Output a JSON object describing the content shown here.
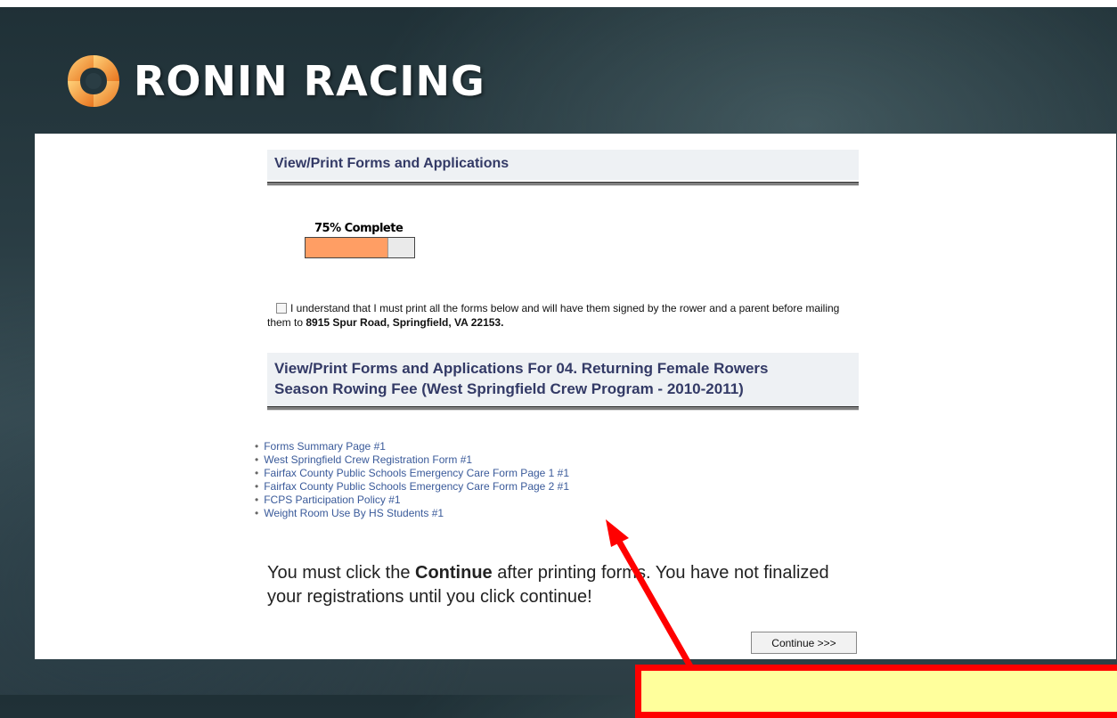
{
  "brand": {
    "name": "RONIN RACING"
  },
  "header1": {
    "title": "View/Print Forms and Applications"
  },
  "progress": {
    "label": "75% Complete",
    "percent": 75
  },
  "agreement": {
    "text": "I understand that I must print all the forms below and will have them signed by the rower and a parent before mailing them to ",
    "address": "8915 Spur Road, Springfield, VA 22153."
  },
  "header2": {
    "line1": "View/Print Forms and Applications For 04. Returning Female Rowers",
    "line2": "Season Rowing Fee (West Springfield Crew Program - 2010-2011)"
  },
  "forms": [
    "Forms Summary Page #1",
    "West Springfield Crew Registration Form #1",
    "Fairfax County Public Schools Emergency Care Form Page 1 #1",
    "Fairfax County Public Schools Emergency Care Form Page 2 #1",
    "FCPS Participation Policy #1",
    "Weight Room Use By HS Students #1"
  ],
  "notice": {
    "part1": "You must click the ",
    "bold": "Continue",
    "part2": " after printing forms. You have not finalized your registrations until you click continue!"
  },
  "continue_button": "Continue >>>",
  "colors": {
    "accent_red": "#ff0000",
    "callout_fill": "#ffff9c",
    "progress_fill": "#ff9e64"
  }
}
